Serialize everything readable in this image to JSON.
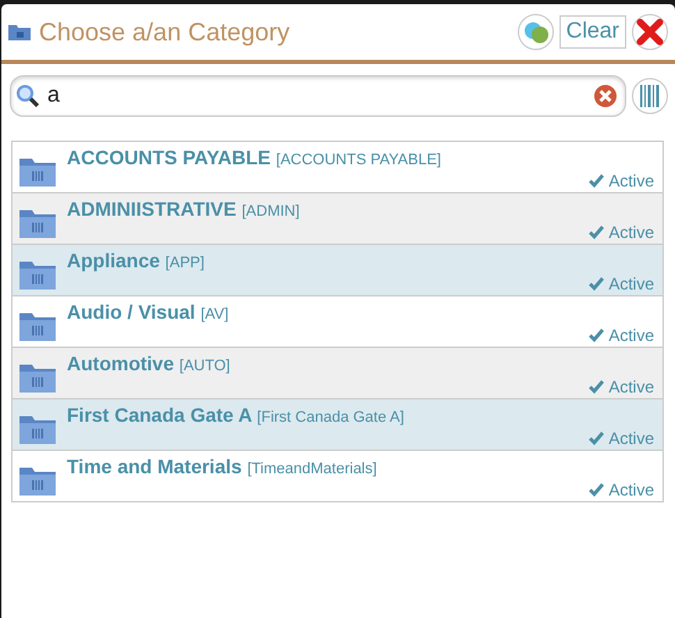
{
  "dialog": {
    "title": "Choose a/an Category",
    "clear_button": "Clear"
  },
  "search": {
    "value": "a"
  },
  "items": [
    {
      "name": "ACCOUNTS PAYABLE",
      "code": "[ACCOUNTS PAYABLE]",
      "status": "Active",
      "active": true,
      "kind": "plain"
    },
    {
      "name": "ADMINIISTRATIVE",
      "code": "[ADMIN]",
      "status": "Active",
      "active": true,
      "kind": "striped"
    },
    {
      "name": "Appliance",
      "code": "[APP]",
      "status": "Active",
      "active": true,
      "kind": "highlighted"
    },
    {
      "name": "Audio / Visual",
      "code": "[AV]",
      "status": "Active",
      "active": true,
      "kind": "plain"
    },
    {
      "name": "Automotive",
      "code": "[AUTO]",
      "status": "Active",
      "active": true,
      "kind": "striped"
    },
    {
      "name": "First Canada Gate A",
      "code": "[First Canada Gate A]",
      "status": "Active",
      "active": true,
      "kind": "highlighted"
    },
    {
      "name": "Time and Materials",
      "code": "[TimeandMaterials]",
      "status": "Active",
      "active": true,
      "kind": "plain"
    }
  ]
}
